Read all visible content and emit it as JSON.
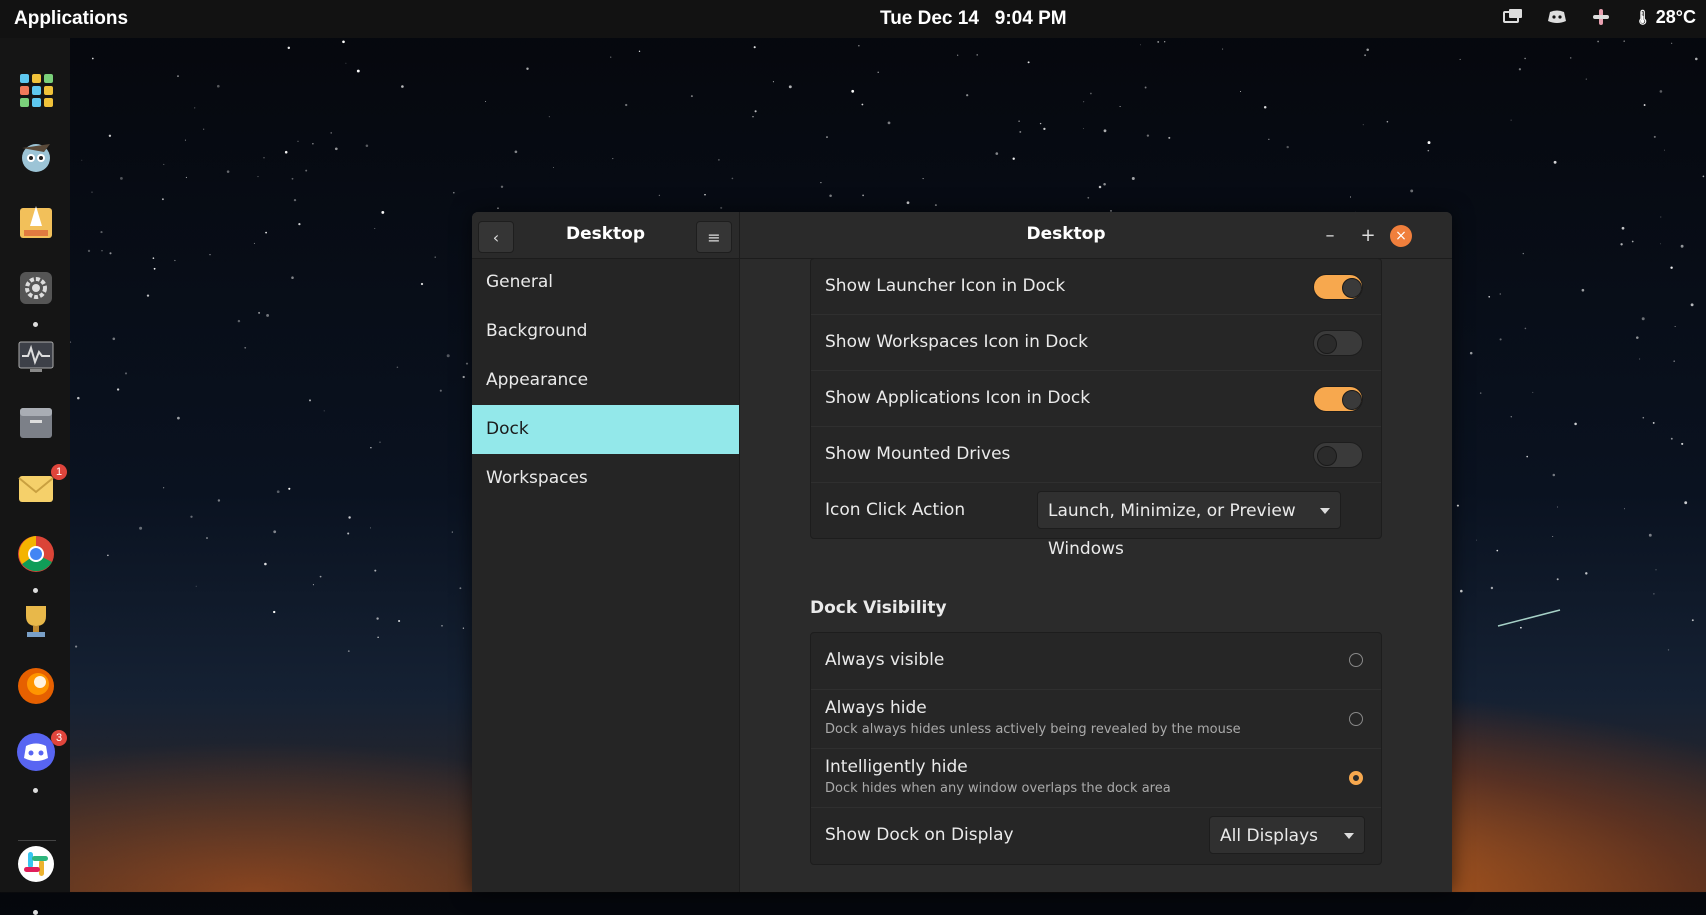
{
  "topbar": {
    "applications_label": "Applications",
    "date": "Tue Dec 14",
    "time": "9:04 PM",
    "temperature": "28°C"
  },
  "dock": {
    "items": [
      {
        "name": "app-grid-icon",
        "badge": null,
        "running": false
      },
      {
        "name": "bird-app-icon",
        "badge": null,
        "running": false
      },
      {
        "name": "rocket-app-icon",
        "badge": null,
        "running": false
      },
      {
        "name": "settings-icon",
        "badge": null,
        "running": true
      },
      {
        "name": "system-monitor-icon",
        "badge": null,
        "running": false
      },
      {
        "name": "files-icon",
        "badge": null,
        "running": false
      },
      {
        "name": "mail-icon",
        "badge": "1",
        "running": false
      },
      {
        "name": "chrome-icon",
        "badge": null,
        "running": true
      },
      {
        "name": "trophy-icon",
        "badge": null,
        "running": false
      },
      {
        "name": "firefox-icon",
        "badge": null,
        "running": false
      },
      {
        "name": "discord-icon",
        "badge": "3",
        "running": true
      },
      {
        "name": "slack-icon",
        "badge": null,
        "running": true
      }
    ]
  },
  "window": {
    "sidebar_title": "Desktop",
    "main_title": "Desktop",
    "sidebar_items": [
      "General",
      "Background",
      "Appearance",
      "Dock",
      "Workspaces"
    ],
    "active_item": "Dock",
    "controls": {
      "minimize": "–",
      "maximize": "+",
      "close": "×"
    }
  },
  "settings": {
    "show_launcher": {
      "label": "Show Launcher Icon in Dock",
      "on": true
    },
    "show_workspaces": {
      "label": "Show Workspaces Icon in Dock",
      "on": false
    },
    "show_applications": {
      "label": "Show Applications Icon in Dock",
      "on": true
    },
    "show_drives": {
      "label": "Show Mounted Drives",
      "on": false
    },
    "icon_click": {
      "label": "Icon Click Action",
      "value": "Launch, Minimize, or Preview Windows"
    }
  },
  "dock_visibility": {
    "title": "Dock Visibility",
    "always_visible": {
      "label": "Always visible",
      "selected": false
    },
    "always_hide": {
      "label": "Always hide",
      "desc": "Dock always hides unless actively being revealed by the mouse",
      "selected": false
    },
    "intelligently_hide": {
      "label": "Intelligently hide",
      "desc": "Dock hides when any window overlaps the dock area",
      "selected": true
    },
    "show_on_display": {
      "label": "Show Dock on Display",
      "value": "All Displays"
    }
  },
  "colors": {
    "accent": "#f7a84e",
    "selection": "#93e8ea",
    "badge": "#e0453b"
  }
}
